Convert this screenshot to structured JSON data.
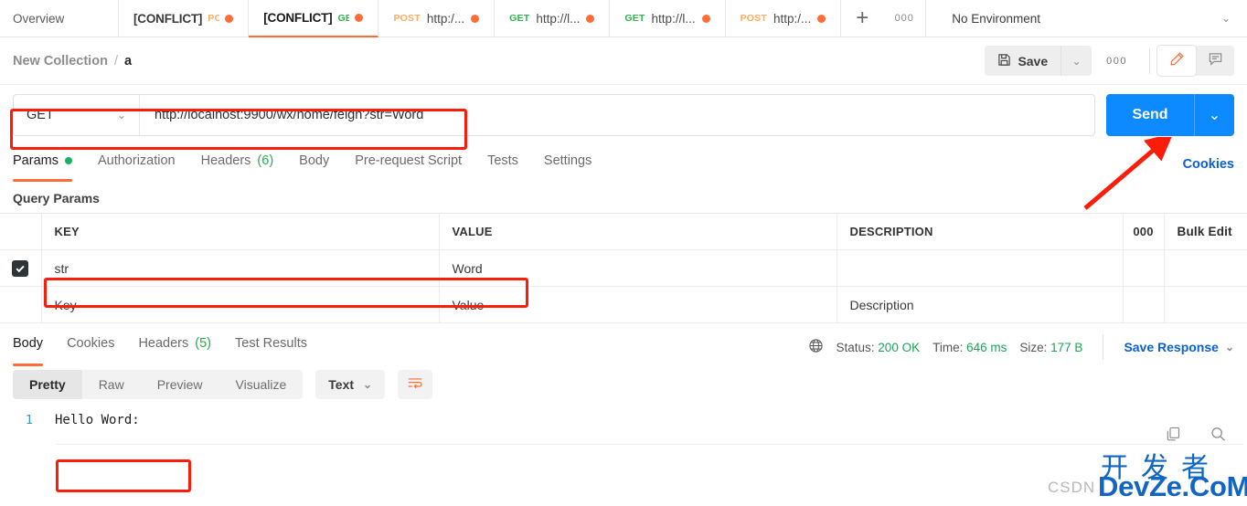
{
  "tabbar": {
    "overview_label": "Overview",
    "tabs": [
      {
        "title": "[CONFLICT]",
        "method": "PO",
        "method_type": "post",
        "unsaved": true,
        "active": false
      },
      {
        "title": "[CONFLICT]",
        "method": "GE",
        "method_type": "get",
        "unsaved": true,
        "active": true
      },
      {
        "title": "http:/...",
        "method": "POST",
        "method_type": "post",
        "unsaved": true,
        "active": false
      },
      {
        "title": "http://l...",
        "method": "GET",
        "method_type": "get",
        "unsaved": true,
        "active": false
      },
      {
        "title": "http://l...",
        "method": "GET",
        "method_type": "get",
        "unsaved": true,
        "active": false
      },
      {
        "title": "http:/...",
        "method": "POST",
        "method_type": "post",
        "unsaved": true,
        "active": false
      }
    ],
    "add_label": "+",
    "more_label": "000",
    "environment": "No Environment",
    "environment_caret": "⌄"
  },
  "breadcrumb": {
    "collection": "New Collection",
    "separator": "/",
    "request": "a"
  },
  "actions": {
    "save_label": "Save",
    "save_icon": "floppy-disk-icon",
    "save_caret": "⌄",
    "more_label": "000",
    "edit_icon": "pencil-icon",
    "comment_icon": "comment-icon"
  },
  "request": {
    "method": "GET",
    "method_caret": "⌄",
    "url": "http://localhost:9900/wx/home/feign?str=Word",
    "send_label": "Send",
    "send_caret": "⌄"
  },
  "request_tabs": {
    "items": [
      {
        "label": "Params",
        "badge": "dot",
        "active": true
      },
      {
        "label": "Authorization",
        "badge": "",
        "active": false
      },
      {
        "label": "Headers",
        "badge": "(6)",
        "active": false
      },
      {
        "label": "Body",
        "badge": "",
        "active": false
      },
      {
        "label": "Pre-request Script",
        "badge": "",
        "active": false
      },
      {
        "label": "Tests",
        "badge": "",
        "active": false
      },
      {
        "label": "Settings",
        "badge": "",
        "active": false
      }
    ],
    "cookies_link": "Cookies"
  },
  "query_params": {
    "title": "Query Params",
    "columns": [
      "KEY",
      "VALUE",
      "DESCRIPTION"
    ],
    "row_more": "000",
    "bulk_edit": "Bulk Edit",
    "rows": [
      {
        "checked": true,
        "key": "str",
        "value": "Word",
        "description": ""
      }
    ],
    "placeholders": {
      "key": "Key",
      "value": "Value",
      "description": "Description"
    }
  },
  "response": {
    "tabs": [
      {
        "label": "Body",
        "badge": "",
        "active": true
      },
      {
        "label": "Cookies",
        "badge": "",
        "active": false
      },
      {
        "label": "Headers",
        "badge": "(5)",
        "active": false
      },
      {
        "label": "Test Results",
        "badge": "",
        "active": false
      }
    ],
    "globe_icon": "globe-icon",
    "status_label": "Status:",
    "status_value": "200 OK",
    "time_label": "Time:",
    "time_value": "646 ms",
    "size_label": "Size:",
    "size_value": "177 B",
    "save_response": "Save Response",
    "save_response_caret": "⌄",
    "format_tabs": [
      {
        "label": "Pretty",
        "active": true
      },
      {
        "label": "Raw",
        "active": false
      },
      {
        "label": "Preview",
        "active": false
      },
      {
        "label": "Visualize",
        "active": false
      }
    ],
    "type_label": "Text",
    "type_caret": "⌄",
    "wrap_icon": "word-wrap-icon",
    "copy_icon": "copy-icon",
    "search_icon": "search-icon",
    "body_lines": [
      {
        "no": "1",
        "text": "Hello Word:"
      }
    ]
  },
  "watermark": {
    "csdn": "CSDN",
    "cn": "开发者",
    "en": "DevZe.CoM"
  },
  "colors": {
    "accent": "#ff6c37",
    "send_blue": "#0d8aff",
    "link_blue": "#0b5fd7",
    "status_green": "#18a558",
    "annotation_red": "#fb1c09"
  }
}
